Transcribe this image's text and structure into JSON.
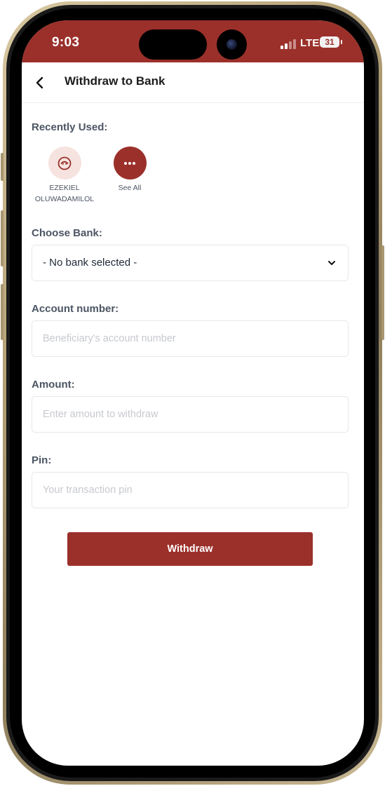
{
  "status_bar": {
    "time": "9:03",
    "network": "LTE",
    "battery": "31"
  },
  "header": {
    "title": "Withdraw to Bank",
    "back_icon": "chevron-left-icon"
  },
  "recent": {
    "label": "Recently Used:",
    "items": [
      {
        "name_line1": "EZEKIEL",
        "name_line2": "OLUWADAMILOL",
        "icon": "avatar-icon"
      },
      {
        "name_line1": "See All",
        "name_line2": "",
        "icon": "more-dots-icon"
      }
    ]
  },
  "bank": {
    "label": "Choose Bank:",
    "selected": "- No bank selected -",
    "icon": "chevron-down-icon"
  },
  "account": {
    "label": "Account number:",
    "placeholder": "Beneficiary's account number",
    "value": ""
  },
  "amount": {
    "label": "Amount:",
    "placeholder": "Enter amount to withdraw",
    "value": ""
  },
  "pin": {
    "label": "Pin:",
    "placeholder": "Your transaction pin",
    "value": ""
  },
  "submit": {
    "label": "Withdraw"
  },
  "colors": {
    "accent": "#9b302a",
    "accent_light": "#f6e3df",
    "label_text": "#4b5563",
    "placeholder": "#c7c9cf"
  }
}
